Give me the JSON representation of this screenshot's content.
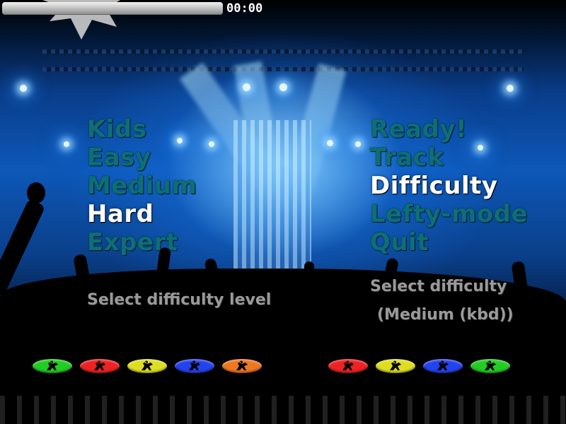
{
  "hud": {
    "time": "00:00",
    "song_progress": 0
  },
  "difficulty_menu": {
    "items": [
      {
        "label": "Kids",
        "active": false
      },
      {
        "label": "Easy",
        "active": false
      },
      {
        "label": "Medium",
        "active": false
      },
      {
        "label": "Hard",
        "active": true
      },
      {
        "label": "Expert",
        "active": false
      }
    ],
    "help": "Select difficulty level"
  },
  "main_menu": {
    "items": [
      {
        "label": "Ready!",
        "active": false
      },
      {
        "label": "Track",
        "active": false
      },
      {
        "label": "Difficulty",
        "active": true
      },
      {
        "label": "Lefty-mode",
        "active": false
      },
      {
        "label": "Quit",
        "active": false
      }
    ],
    "help_line1": "Select difficulty",
    "help_line2": "(Medium (kbd))"
  },
  "player_icons": {
    "left": [
      {
        "icon": "guitarist-icon",
        "color": "#22cc22"
      },
      {
        "icon": "guitarist-icon",
        "color": "#ee2222"
      },
      {
        "icon": "guitarist-icon",
        "color": "#dddd22"
      },
      {
        "icon": "guitarist-icon",
        "color": "#2244ee"
      },
      {
        "icon": "guitarist-icon",
        "color": "#ee7722"
      }
    ],
    "right": [
      {
        "icon": "guitarist-icon",
        "color": "#ee2222"
      },
      {
        "icon": "guitarist-icon",
        "color": "#dddd22"
      },
      {
        "icon": "guitarist-icon",
        "color": "#2244ee"
      },
      {
        "icon": "guitarist-icon",
        "color": "#22cc22"
      }
    ]
  },
  "colors": {
    "menu_inactive": "#0d6f75",
    "menu_active": "#ffffff",
    "help_text": "#9a9a9a"
  }
}
